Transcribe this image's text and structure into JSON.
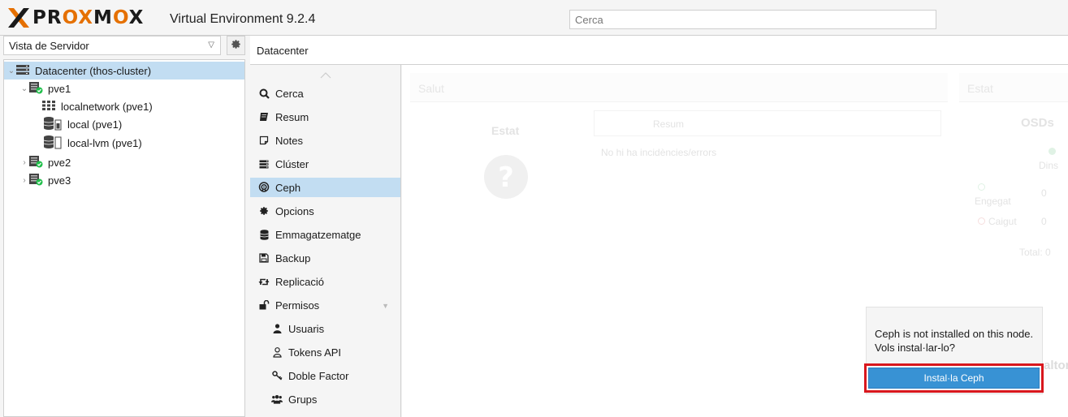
{
  "header": {
    "logo_prefix": "PR",
    "logo_ox": "OX",
    "logo_m": "M",
    "logo_suffix": "X",
    "version": "Virtual Environment 9.2.4",
    "search_placeholder": "Cerca"
  },
  "tree": {
    "view_select": "Vista de Servidor",
    "items": [
      {
        "label": "Datacenter (thos-cluster)",
        "icon": "datacenter-icon"
      },
      {
        "label": "pve1",
        "icon": "node-online-icon"
      },
      {
        "label": "localnetwork (pve1)",
        "icon": "sdn-zone-icon"
      },
      {
        "label": "local (pve1)",
        "icon": "storage-icon"
      },
      {
        "label": "local-lvm (pve1)",
        "icon": "storage-icon"
      },
      {
        "label": "pve2",
        "icon": "node-online-icon"
      },
      {
        "label": "pve3",
        "icon": "node-online-icon"
      }
    ]
  },
  "content": {
    "title": "Datacenter"
  },
  "nav": {
    "items": [
      {
        "label": "Cerca",
        "icon": "search-icon"
      },
      {
        "label": "Resum",
        "icon": "book-icon"
      },
      {
        "label": "Notes",
        "icon": "notes-icon"
      },
      {
        "label": "Clúster",
        "icon": "server-icon"
      },
      {
        "label": "Ceph",
        "icon": "ceph-icon"
      },
      {
        "label": "Opcions",
        "icon": "gear-icon"
      },
      {
        "label": "Emmagatzematge",
        "icon": "database-icon"
      },
      {
        "label": "Backup",
        "icon": "floppy-icon"
      },
      {
        "label": "Replicació",
        "icon": "retweet-icon"
      },
      {
        "label": "Permisos",
        "icon": "unlock-icon"
      },
      {
        "label": "Usuaris",
        "icon": "user-icon"
      },
      {
        "label": "Tokens API",
        "icon": "user-outline-icon"
      },
      {
        "label": "Doble Factor",
        "icon": "key-icon"
      },
      {
        "label": "Grups",
        "icon": "users-icon"
      }
    ]
  },
  "dashboard": {
    "health_title": "Salut",
    "status_title": "Estat",
    "status_label": "Estat",
    "summary_col": "Resum",
    "no_issues": "No hi ha incidències/errors",
    "osds_title": "OSDs",
    "osd_in": "Dins",
    "osd_up": "Engegat",
    "osd_down": "Caigut",
    "osd_up_value": "0",
    "osd_down_value": "0",
    "osd_total": "Total: 0",
    "partial_label": "altor"
  },
  "popup": {
    "message_line1": "Ceph is not installed on this node.",
    "message_line2": "Vols instal·lar-lo?",
    "install_button": "Instal·la Ceph"
  },
  "colors": {
    "accent": "#3892d4",
    "selection": "#c2ddf2",
    "highlight_border": "#d9171d",
    "logo_orange": "#e57000"
  }
}
